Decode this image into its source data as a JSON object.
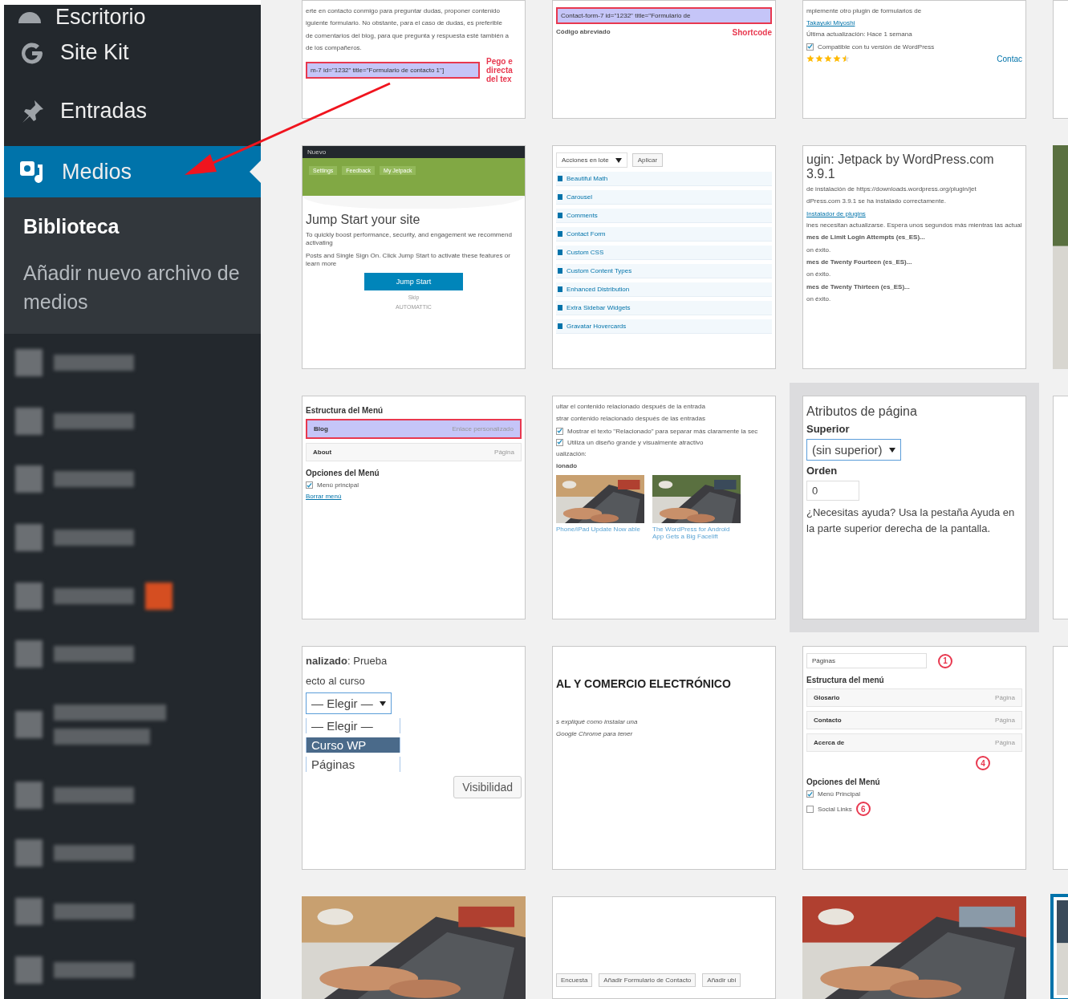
{
  "sidebar": {
    "items": [
      {
        "kind": "menu",
        "label": "Escritorio",
        "selected": false
      },
      {
        "kind": "menu",
        "label": "Site Kit",
        "selected": false
      },
      {
        "kind": "menu",
        "label": "Entradas",
        "selected": false
      },
      {
        "kind": "menu",
        "label": "Medios",
        "selected": true,
        "submenu": [
          {
            "label": "Biblioteca",
            "selected": true
          },
          {
            "label": "Añadir nuevo archivo de medios",
            "selected": false
          }
        ]
      },
      {
        "kind": "blurred",
        "badge": false,
        "tall": false
      },
      {
        "kind": "blurred",
        "badge": false,
        "tall": false
      },
      {
        "kind": "blurred",
        "badge": false,
        "tall": false
      },
      {
        "kind": "blurred",
        "badge": false,
        "tall": false
      },
      {
        "kind": "blurred",
        "badge": true,
        "tall": false
      },
      {
        "kind": "blurred",
        "badge": false,
        "tall": false
      },
      {
        "kind": "blurred",
        "badge": false,
        "tall": true
      },
      {
        "kind": "blurred",
        "badge": false,
        "tall": false
      },
      {
        "kind": "blurred",
        "badge": false,
        "tall": false
      },
      {
        "kind": "blurred",
        "badge": false,
        "tall": false
      },
      {
        "kind": "blurred",
        "badge": false,
        "tall": false
      }
    ]
  },
  "media_grid": {
    "tiles": [
      {
        "kind": "screenshot",
        "lines": [
          {
            "kind": "text",
            "text": "erte en contacto conmigo para preguntar dudas, proponer contenido"
          },
          {
            "kind": "text",
            "text": "iguiente formulario. No obstante, para el caso de dudas, es preferible"
          },
          {
            "kind": "text",
            "text": "de comentarios del blog, para que pregunta y respuesta esté también a"
          },
          {
            "kind": "text",
            "text": "de los compañeros."
          },
          {
            "kind": "highlight",
            "text": "m-7 id=\"1232\" title=\"Formulario de contacto 1\"]",
            "note": "Pego e directa del tex"
          }
        ]
      },
      {
        "kind": "screenshot",
        "lines": [
          {
            "kind": "highlight",
            "text": "Contact-form-7 id=\"1232\" title=\"Formulario de"
          },
          {
            "kind": "pair",
            "text": "Código abreviado",
            "note": "Shortcode"
          }
        ]
      },
      {
        "kind": "screenshot",
        "lines": [
          {
            "kind": "text",
            "text": "mplemente otro plugin de formularios de"
          },
          {
            "kind": "link",
            "text": "Takayuki Miyoshi"
          },
          {
            "kind": "text",
            "text": "Última actualización: Hace 1 semana"
          },
          {
            "kind": "check",
            "checked": true,
            "text": "Compatible con tu versión de WordPress"
          },
          {
            "kind": "stars",
            "stars": 4.5,
            "text": "Contac"
          }
        ]
      },
      {
        "kind": "screenshot"
      },
      {
        "kind": "screenshot",
        "lines": [
          {
            "kind": "topbar",
            "text": "Nuevo"
          },
          {
            "kind": "banner",
            "tabs": [
              "Settings",
              "Feedback",
              "My Jetpack"
            ]
          },
          {
            "kind": "title",
            "text": "Jump Start your site"
          },
          {
            "kind": "text",
            "text": "To quickly boost performance, security, and engagement we recommend activating"
          },
          {
            "kind": "text",
            "text": "Posts and Single Sign On. Click Jump Start to activate these features or learn more"
          },
          {
            "kind": "primary-button",
            "text": "Jump Start"
          },
          {
            "kind": "center",
            "text": "Skip"
          },
          {
            "kind": "center",
            "text": "AUTOMATTIC"
          }
        ]
      },
      {
        "kind": "screenshot",
        "lines": [
          {
            "kind": "select",
            "text": "Acciones en lote",
            "button": "Aplicar"
          },
          {
            "kind": "module",
            "text": "Beautiful Math"
          },
          {
            "kind": "module",
            "text": "Carousel"
          },
          {
            "kind": "module",
            "text": "Comments"
          },
          {
            "kind": "module",
            "text": "Contact Form"
          },
          {
            "kind": "module",
            "text": "Custom CSS"
          },
          {
            "kind": "module",
            "text": "Custom Content Types"
          },
          {
            "kind": "module",
            "text": "Enhanced Distribution"
          },
          {
            "kind": "module",
            "text": "Extra Sidebar Widgets"
          },
          {
            "kind": "module",
            "text": "Gravatar Hovercards"
          }
        ]
      },
      {
        "kind": "screenshot",
        "lines": [
          {
            "kind": "title",
            "text": "ugin: Jetpack by WordPress.com 3.9.1"
          },
          {
            "kind": "text",
            "text": "de instalación de https://downloads.wordpress.org/plugin/jet"
          },
          {
            "kind": "text",
            "text": "dPress.com 3.9.1 se ha instalado correctamente."
          },
          {
            "kind": "link",
            "text": "Instalador de plugins"
          },
          {
            "kind": "text",
            "text": "ines necesitan actualizarse. Espera unos segundos más mientras las actual"
          },
          {
            "kind": "bold",
            "text": "mes de Limit Login Attempts (es_ES)..."
          },
          {
            "kind": "text",
            "text": "on éxito."
          },
          {
            "kind": "bold",
            "text": "mes de Twenty Fourteen (es_ES)..."
          },
          {
            "kind": "text",
            "text": "on éxito."
          },
          {
            "kind": "bold",
            "text": "mes de Twenty Thirteen (es_ES)..."
          },
          {
            "kind": "text",
            "text": "on éxito."
          }
        ]
      },
      {
        "kind": "picture"
      },
      {
        "kind": "screenshot",
        "lines": [
          {
            "kind": "heading",
            "text": "Estructura del Menú"
          },
          {
            "kind": "item",
            "text": "Blog",
            "note": "Enlace personalizado",
            "selected": true
          },
          {
            "kind": "item",
            "text": "About",
            "note": "Página",
            "selected": false
          },
          {
            "kind": "heading",
            "text": "Opciones del Menú"
          },
          {
            "kind": "check",
            "checked": true,
            "text": "Menú principal"
          },
          {
            "kind": "link",
            "text": "Borrar menú"
          }
        ]
      },
      {
        "kind": "screenshot",
        "lines": [
          {
            "kind": "text",
            "text": "ultar el contenido relacionado después de la entrada"
          },
          {
            "kind": "text",
            "text": "strar contenido relacionado después de las entradas"
          },
          {
            "kind": "check",
            "checked": true,
            "text": "Mostrar el texto \"Relacionado\" para separar más claramente la sec"
          },
          {
            "kind": "check",
            "checked": true,
            "text": "Utiliza un diseño grande y visualmente atractivo"
          },
          {
            "kind": "text",
            "text": "ualización:"
          },
          {
            "kind": "bold",
            "text": "ionado"
          },
          {
            "kind": "photos",
            "captions": [
              "Phone/iPad Update Now able",
              "The WordPress for Android App Gets a Big Facelift"
            ]
          }
        ]
      },
      {
        "kind": "panel",
        "lines": [
          {
            "kind": "title",
            "text": "Atributos de página"
          },
          {
            "kind": "label",
            "text": "Superior"
          },
          {
            "kind": "select",
            "text": "(sin superior)"
          },
          {
            "kind": "label",
            "text": "Orden"
          },
          {
            "kind": "field",
            "text": "0"
          },
          {
            "kind": "para",
            "text": "¿Necesitas ayuda? Usa la pestaña Ayuda en la parte superior derecha de la pantalla."
          }
        ]
      },
      {
        "kind": "screenshot"
      },
      {
        "kind": "screenshot",
        "lines": [
          {
            "kind": "para",
            "text": "**nalizado**: Prueba"
          },
          {
            "kind": "para",
            "text": "ecto al curso"
          },
          {
            "kind": "select",
            "text": "— Elegir —"
          },
          {
            "kind": "option",
            "text": "— Elegir —",
            "selected": false
          },
          {
            "kind": "option",
            "text": "Curso WP",
            "selected": true
          },
          {
            "kind": "option",
            "text": "Páginas",
            "selected": false
          },
          {
            "kind": "button",
            "text": "Visibilidad"
          }
        ]
      },
      {
        "kind": "screenshot",
        "lines": [
          {
            "kind": "headline",
            "text": "AL Y COMERCIO ELECTRÓNICO"
          },
          {
            "kind": "italic",
            "text": "s expliqué como instalar una"
          },
          {
            "kind": "italic",
            "text": "Google Chrome para tener"
          }
        ]
      },
      {
        "kind": "screenshot",
        "lines": [
          {
            "kind": "field",
            "text": "Páginas",
            "note": "1"
          },
          {
            "kind": "heading",
            "text": "Estructura del menú"
          },
          {
            "kind": "item",
            "text": "Glosario",
            "note": "Página",
            "selected": false
          },
          {
            "kind": "item",
            "text": "Contacto",
            "note": "Página",
            "selected": false
          },
          {
            "kind": "item",
            "text": "Acerca de",
            "note": "Página",
            "selected": false
          },
          {
            "kind": "marker",
            "text": "4"
          },
          {
            "kind": "heading",
            "text": "Opciones del Menú"
          },
          {
            "kind": "check",
            "checked": true,
            "text": "Menú Principal"
          },
          {
            "kind": "check",
            "checked": false,
            "text": "Social Links",
            "note": "6"
          }
        ]
      },
      {
        "kind": "screenshot"
      },
      {
        "kind": "picture"
      },
      {
        "kind": "screenshot",
        "lines": [
          {
            "kind": "toolbar",
            "items": [
              "Encuesta",
              "Añadir Formulario de Contacto",
              "Añadir ubi"
            ]
          }
        ]
      },
      {
        "kind": "picture"
      },
      {
        "kind": "picture",
        "selected": true
      }
    ]
  }
}
